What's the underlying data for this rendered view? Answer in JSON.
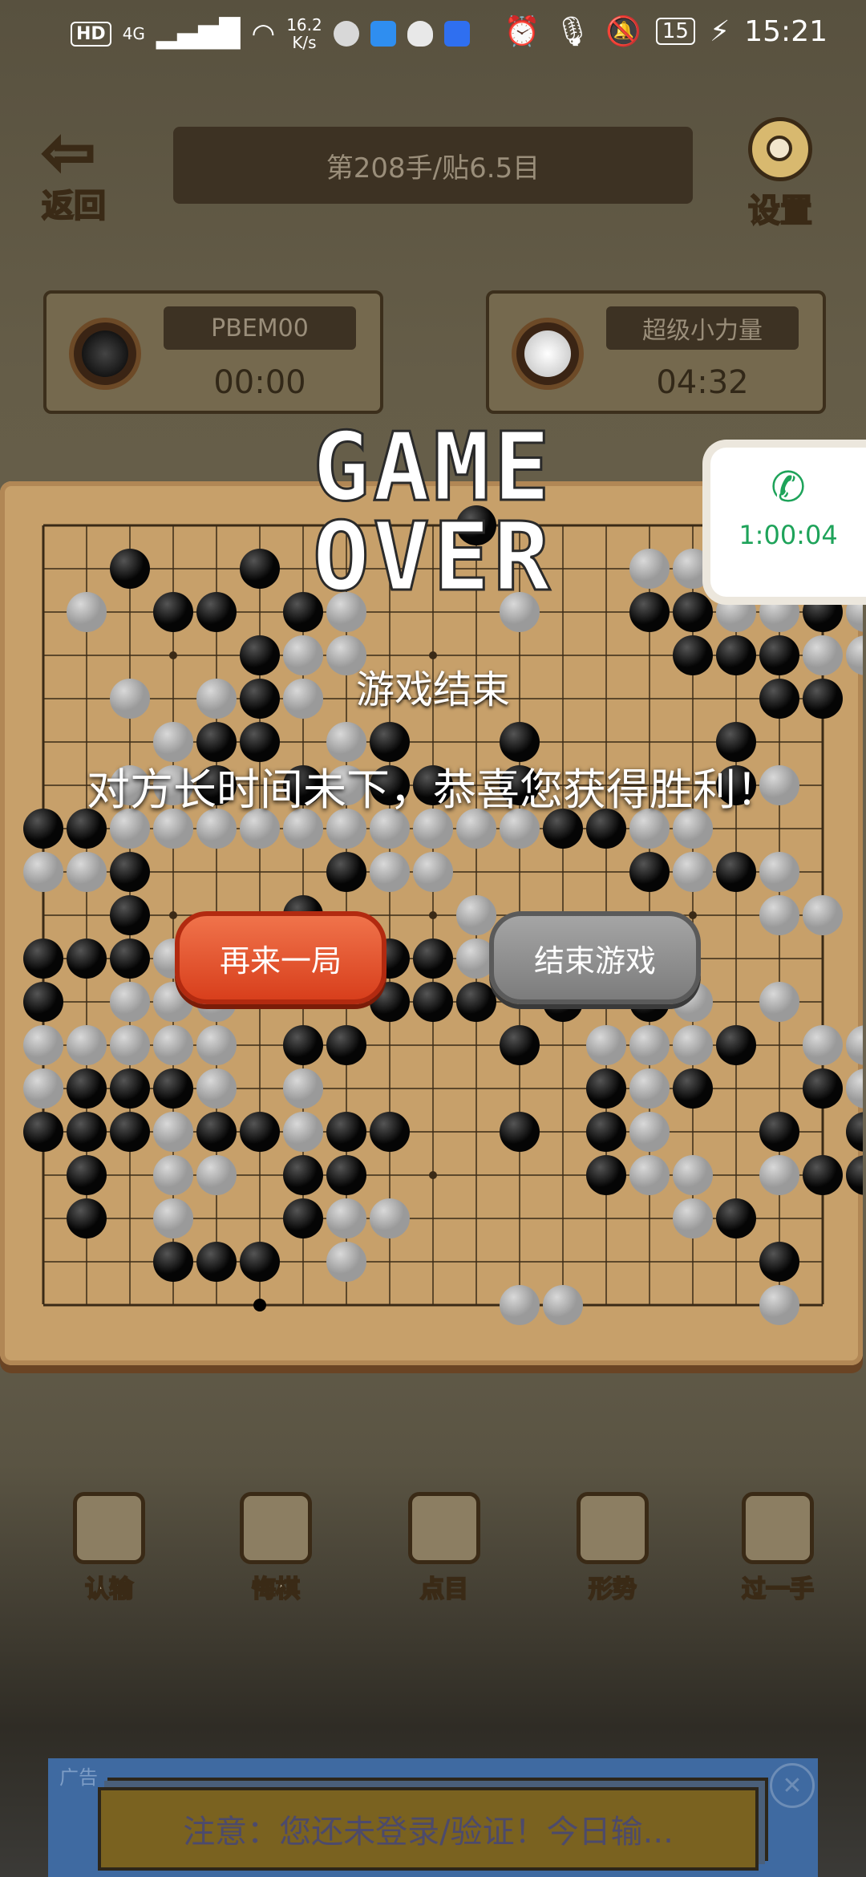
{
  "status_bar": {
    "hd": "HD",
    "network": "4G",
    "speed_value": "16.2",
    "speed_unit": "K/s",
    "battery": "15",
    "time": "15:21"
  },
  "header": {
    "back_label": "返回",
    "title": "第208手/贴6.5目",
    "settings_label": "设置"
  },
  "players": [
    {
      "name": "PBEM00",
      "time": "00:00",
      "stone": "black"
    },
    {
      "name": "超级小力量",
      "time": "04:32",
      "stone": "white"
    }
  ],
  "call": {
    "duration": "1:00:04"
  },
  "overlay": {
    "game_over": "GAME OVER",
    "subtitle": "游戏结束",
    "message": "对方长时间未下，恭喜您获得胜利！",
    "again_label": "再来一局",
    "end_label": "结束游戏"
  },
  "toolbar": [
    {
      "label": "认输",
      "icon": "flag-icon"
    },
    {
      "label": "悔棋",
      "icon": "undo-hand-icon"
    },
    {
      "label": "点目",
      "icon": "gavel-icon"
    },
    {
      "label": "形势",
      "icon": "chart-icon"
    },
    {
      "label": "过一手",
      "icon": "pass-icon"
    }
  ],
  "ad": {
    "tag": "广告",
    "text": "注意：您还未登录/验证！今日输..."
  },
  "board": {
    "size": 19,
    "rows": [
      "..........B.........",
      "..B..B........WWW..",
      ".W.BB.BW...W..BBWWBW",
      ".....BWW.......BBBWW",
      "..W.WBW..........BB",
      "...WBB.WB..B....B..",
      "..WWB.BWBB.B....BW",
      "BBWWWWWWWWWWBBWW",
      "WWB....BWW....BWBW",
      "..B...B...W......WW",
      "BBBWWWBWBBW.B.....",
      "B.WWW...BBB.B.BW.W",
      "WWWWW.BB...B.WWWB.WW",
      "WBBBW.W......BWB..BW",
      "BBBWBBWBB..B.BW..B.B",
      ".B.WW.BB.....BWW.WBB",
      ".B.W..BWW......WB...",
      "...BBB.W.........B",
      "...........WW....W"
    ]
  }
}
